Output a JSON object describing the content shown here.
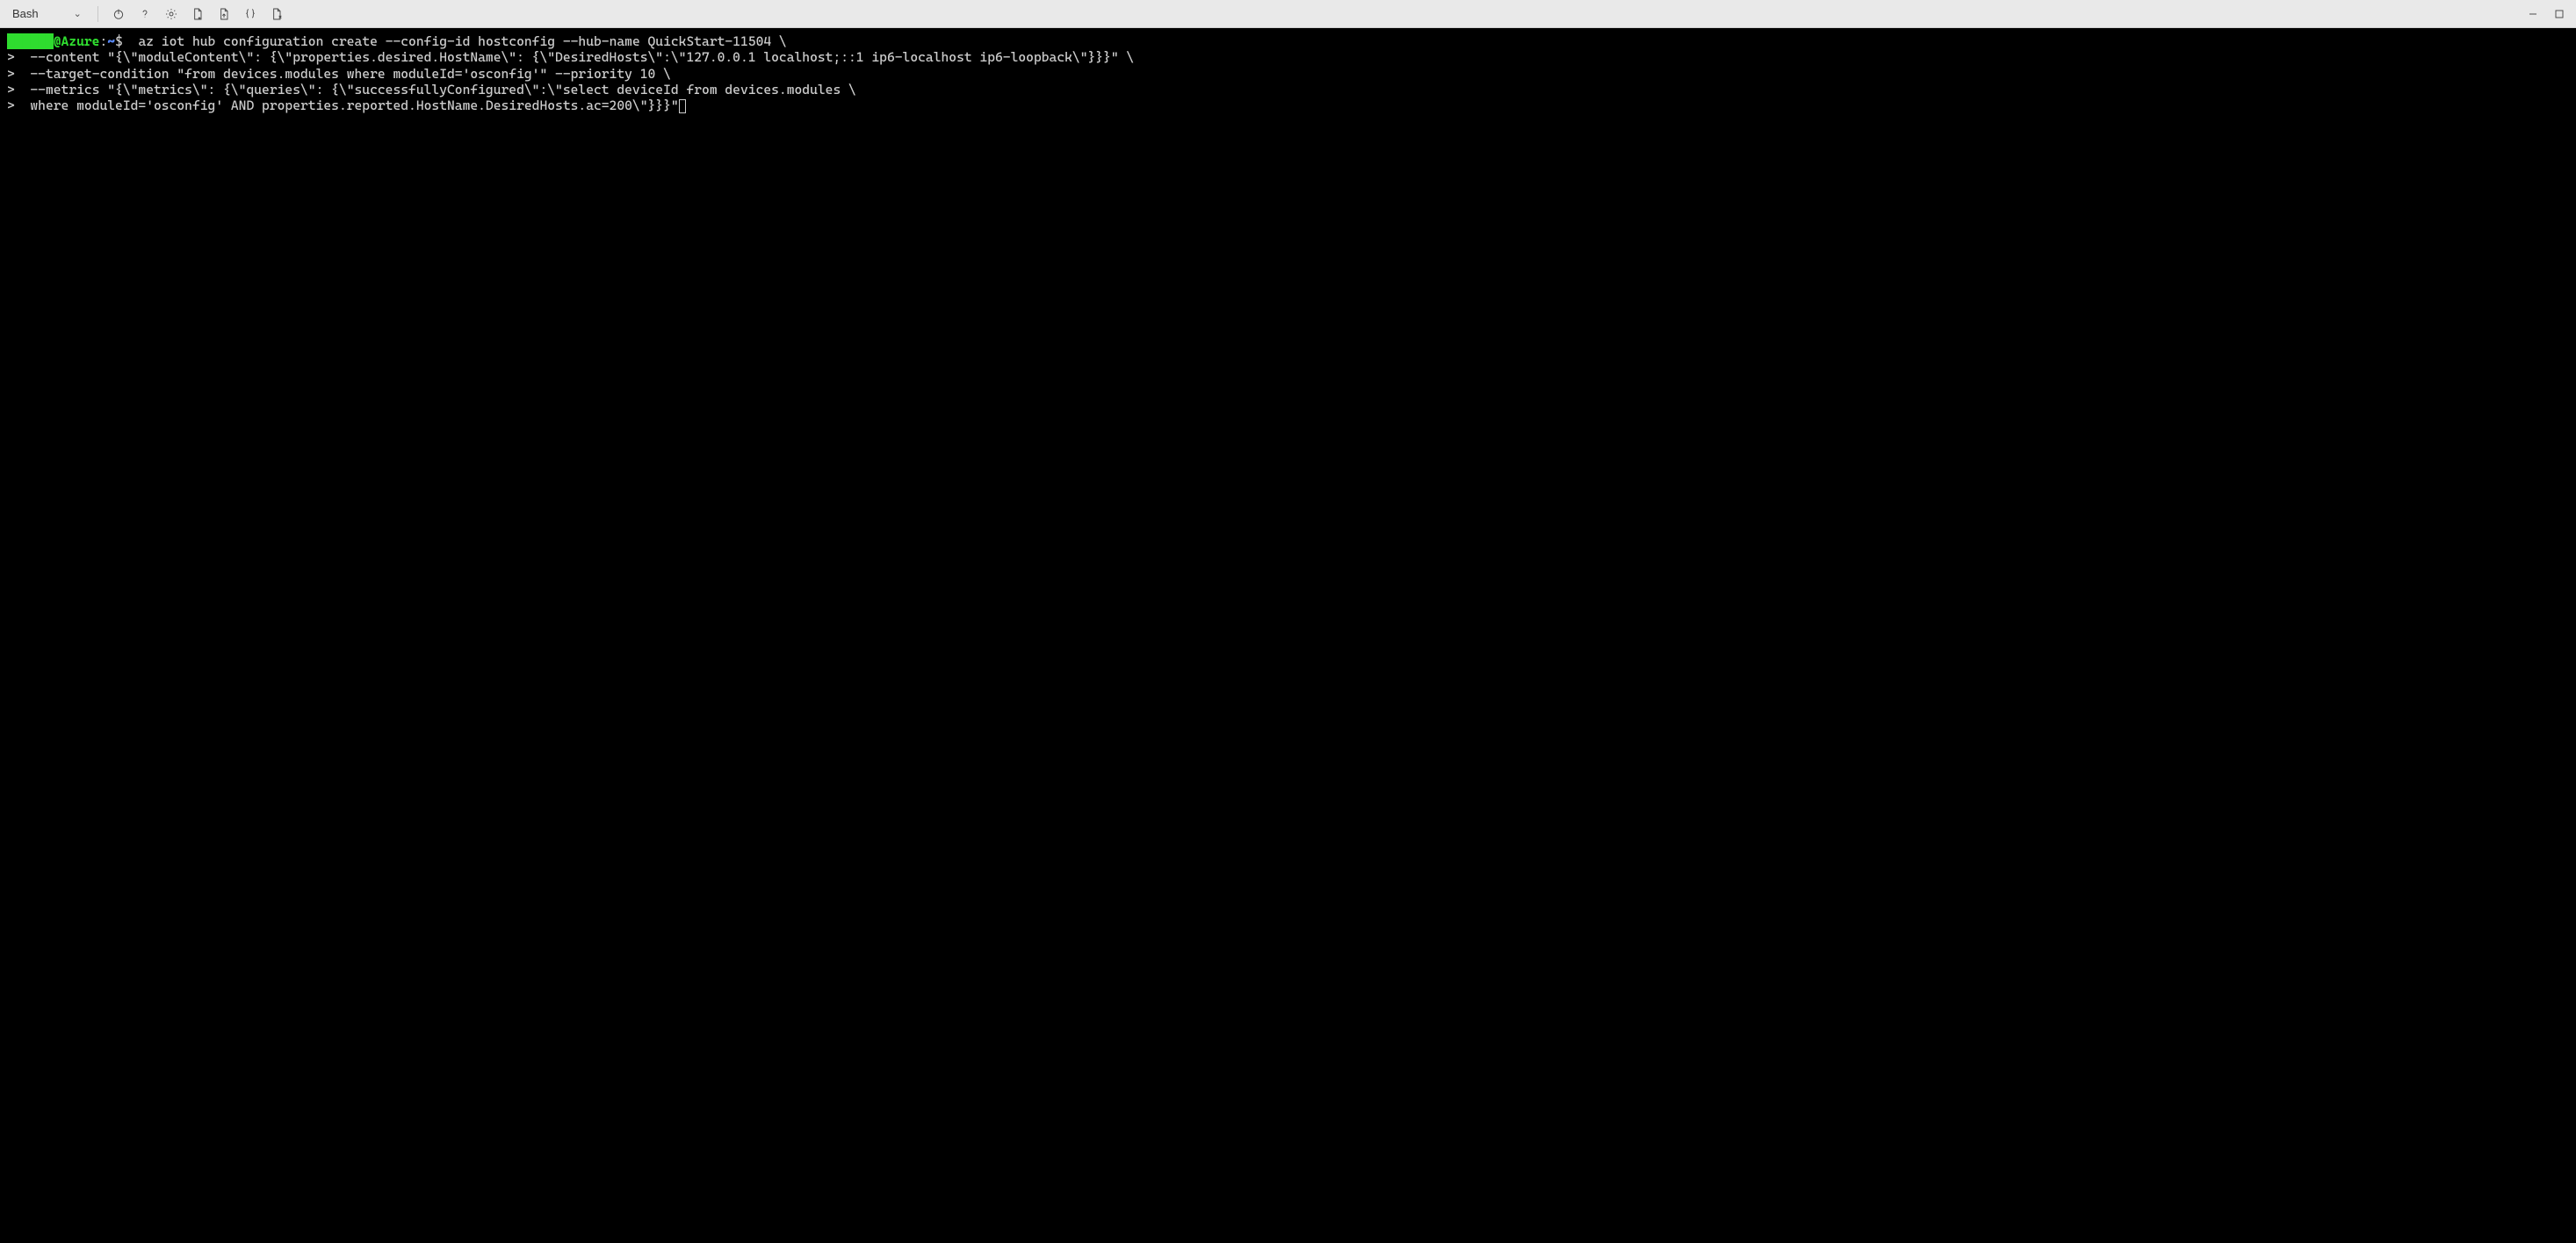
{
  "toolbar": {
    "shell_name": "Bash",
    "icons": {
      "power": "power-icon",
      "help": "help-icon",
      "settings": "settings-icon",
      "new_file": "new-file-icon",
      "upload": "upload-icon",
      "braces": "braces-icon",
      "open_file": "open-file-icon",
      "minimize": "minimize-icon",
      "maximize": "maximize-icon"
    }
  },
  "terminal": {
    "prompt": {
      "user_redacted": "j█████",
      "host": "@Azure",
      "colon": ":",
      "path": "~",
      "dollar": "$"
    },
    "continuation_marker": ">",
    "lines": [
      {
        "prefix_type": "prompt",
        "text": "  az iot hub configuration create --config-id hostconfig --hub-name QuickStart-11504 \\"
      },
      {
        "prefix_type": "cont",
        "text": "  --content \"{\\\"moduleContent\\\": {\\\"properties.desired.HostName\\\": {\\\"DesiredHosts\\\":\\\"127.0.0.1 localhost;::1 ip6-localhost ip6-loopback\\\"}}}\" \\"
      },
      {
        "prefix_type": "cont",
        "text": "  --target-condition \"from devices.modules where moduleId='osconfig'\" --priority 10 \\"
      },
      {
        "prefix_type": "cont",
        "text": "  --metrics \"{\\\"metrics\\\": {\\\"queries\\\": {\\\"successfullyConfigured\\\":\\\"select deviceId from devices.modules \\"
      },
      {
        "prefix_type": "cont",
        "text": "  where moduleId='osconfig' AND properties.reported.HostName.DesiredHosts.ac=200\\\"}}}\"",
        "cursor_after": true
      }
    ]
  }
}
